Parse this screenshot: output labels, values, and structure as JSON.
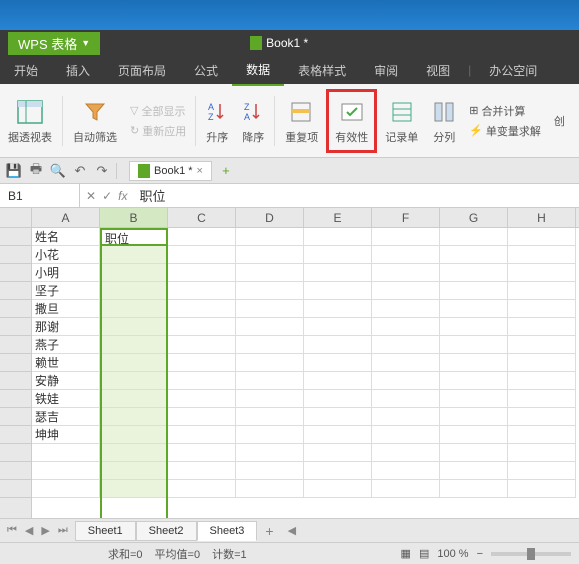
{
  "app": {
    "name": "WPS 表格",
    "doc_title": "Book1 *"
  },
  "menu": {
    "items": [
      "开始",
      "插入",
      "页面布局",
      "公式",
      "数据",
      "表格样式",
      "审阅",
      "视图",
      "办公空间"
    ],
    "active_index": 4
  },
  "ribbon": {
    "pivot": "据透视表",
    "autofilter": "自动筛选",
    "showall": "全部显示",
    "reapply": "重新应用",
    "sort_asc": "升序",
    "sort_desc": "降序",
    "duplicates": "重复项",
    "validation": "有效性",
    "form": "记录单",
    "text_to_cols": "分列",
    "consolidate": "合并计算",
    "solver": "单变量求解",
    "create": "创"
  },
  "doc_tab": {
    "label": "Book1 *"
  },
  "name_box": "B1",
  "formula": "职位",
  "columns": [
    "A",
    "B",
    "C",
    "D",
    "E",
    "F",
    "G",
    "H"
  ],
  "rows": [
    {
      "a": "姓名",
      "b": "职位"
    },
    {
      "a": "小花",
      "b": ""
    },
    {
      "a": "小明",
      "b": ""
    },
    {
      "a": "坚子",
      "b": ""
    },
    {
      "a": "撒旦",
      "b": ""
    },
    {
      "a": "那谢",
      "b": ""
    },
    {
      "a": "燕子",
      "b": ""
    },
    {
      "a": "赖世",
      "b": ""
    },
    {
      "a": "安静",
      "b": ""
    },
    {
      "a": "铁娃",
      "b": ""
    },
    {
      "a": "瑟吉",
      "b": ""
    },
    {
      "a": "坤坤",
      "b": ""
    },
    {
      "a": "",
      "b": ""
    },
    {
      "a": "",
      "b": ""
    },
    {
      "a": "",
      "b": ""
    }
  ],
  "sheets": {
    "tabs": [
      "Sheet1",
      "Sheet2",
      "Sheet3"
    ],
    "active": 2
  },
  "status": {
    "sum": "求和=0",
    "avg": "平均值=0",
    "count": "计数=1",
    "zoom": "100 %"
  }
}
